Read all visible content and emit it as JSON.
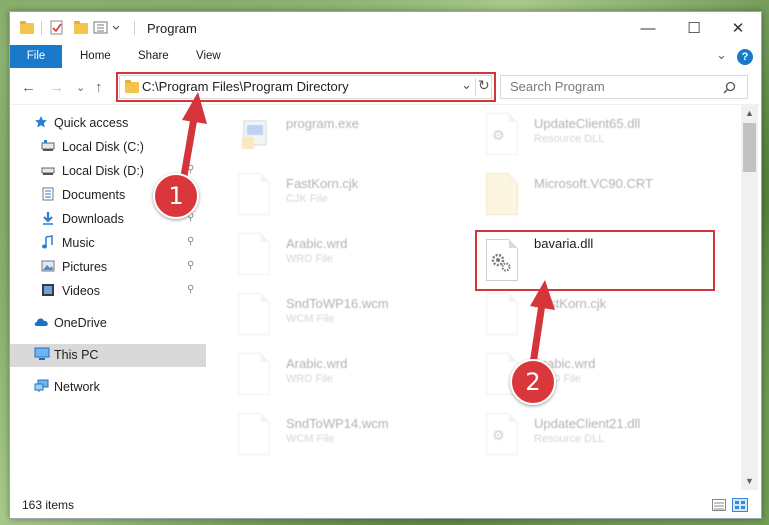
{
  "window": {
    "title": "Program",
    "minimize": "—",
    "maximize": "☐",
    "close": "✕"
  },
  "ribbon": {
    "tabs": [
      "File",
      "Home",
      "Share",
      "View"
    ],
    "help": "?",
    "expand": "⌄"
  },
  "address": {
    "path": "C:\\Program Files\\Program Directory",
    "dropdown": "⌄",
    "refresh": "↻"
  },
  "search": {
    "placeholder": "Search Program",
    "icon": "search-icon"
  },
  "nav": {
    "back": "←",
    "forward": "→",
    "recent": "⌄",
    "up": "↑",
    "items": [
      {
        "label": "Quick access",
        "icon": "star-icon",
        "pinned": false
      },
      {
        "label": "Local Disk (C:)",
        "icon": "drive-icon",
        "pinned": true
      },
      {
        "label": "Local Disk (D:)",
        "icon": "drive-icon",
        "pinned": true
      },
      {
        "label": "Documents",
        "icon": "documents-icon",
        "pinned": true
      },
      {
        "label": "Downloads",
        "icon": "download-icon",
        "pinned": true
      },
      {
        "label": "Music",
        "icon": "music-icon",
        "pinned": true
      },
      {
        "label": "Pictures",
        "icon": "pictures-icon",
        "pinned": true
      },
      {
        "label": "Videos",
        "icon": "videos-icon",
        "pinned": true
      },
      {
        "label": "OneDrive",
        "icon": "cloud-icon",
        "pinned": false
      },
      {
        "label": "This PC",
        "icon": "computer-icon",
        "pinned": false
      },
      {
        "label": "Network",
        "icon": "network-icon",
        "pinned": false
      }
    ],
    "pin_glyph": "📌"
  },
  "files": {
    "left_column": [
      {
        "name": "program.exe",
        "type": ""
      },
      {
        "name": "FastKorn.cjk",
        "type": "CJK File"
      },
      {
        "name": "Arabic.wrd",
        "type": "WRD File"
      },
      {
        "name": "SndToWP16.wcm",
        "type": "WCM File"
      },
      {
        "name": "Arabic.wrd",
        "type": "WRD File"
      },
      {
        "name": "SndToWP14.wcm",
        "type": "WCM File"
      }
    ],
    "right_column": [
      {
        "name": "UpdateClient65.dll",
        "type": "Resource DLL"
      },
      {
        "name": "Microsoft.VC90.CRT",
        "type": ""
      },
      {
        "name": "bavaria.dll",
        "type": ""
      },
      {
        "name": "FastKorn.cjk",
        "type": ""
      },
      {
        "name": "Arabic.wrd",
        "type": "WRD File"
      },
      {
        "name": "UpdateClient21.dll",
        "type": "Resource DLL"
      }
    ]
  },
  "status": {
    "count": "163 items"
  },
  "annotations": {
    "step1": "1",
    "step2": "2",
    "color": "#d4353a"
  }
}
